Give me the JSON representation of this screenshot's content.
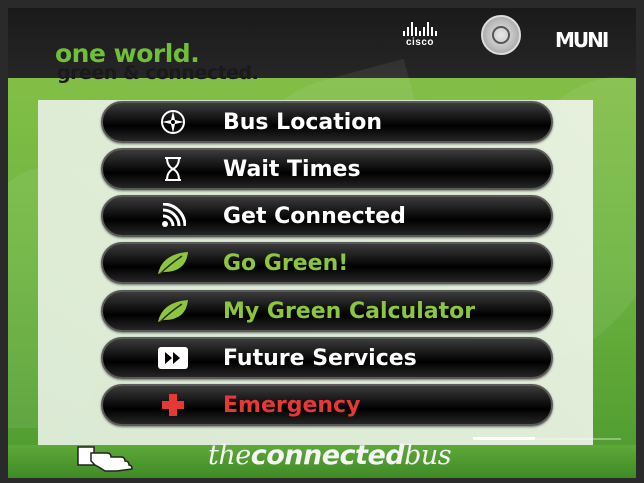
{
  "header": {
    "slogan_line1": "one world.",
    "slogan_line2": "green & connected.",
    "cisco_logo": "cisco",
    "muni_logo": "MUNI"
  },
  "menu": [
    {
      "id": "bus-location",
      "label": "Bus Location",
      "icon": "compass-icon",
      "style": "white"
    },
    {
      "id": "wait-times",
      "label": "Wait Times",
      "icon": "hourglass-icon",
      "style": "white"
    },
    {
      "id": "get-connected",
      "label": "Get Connected",
      "icon": "wifi-icon",
      "style": "white"
    },
    {
      "id": "go-green",
      "label": "Go Green!",
      "icon": "leaf-icon",
      "style": "green"
    },
    {
      "id": "my-green-calculator",
      "label": "My Green Calculator",
      "icon": "leaf-icon",
      "style": "green"
    },
    {
      "id": "future-services",
      "label": "Future Services",
      "icon": "fast-forward-icon",
      "style": "white"
    },
    {
      "id": "emergency",
      "label": "Emergency",
      "icon": "red-cross-icon",
      "style": "red"
    }
  ],
  "footer": {
    "brand_light": "the",
    "brand_bold": "connected",
    "brand_light2": "bus",
    "touch_icon": "touch-hand-icon",
    "progress": 0.42
  },
  "colors": {
    "accent_green": "#8cc63f",
    "emergency_red": "#e53935",
    "button_black": "#0f0f0f"
  }
}
